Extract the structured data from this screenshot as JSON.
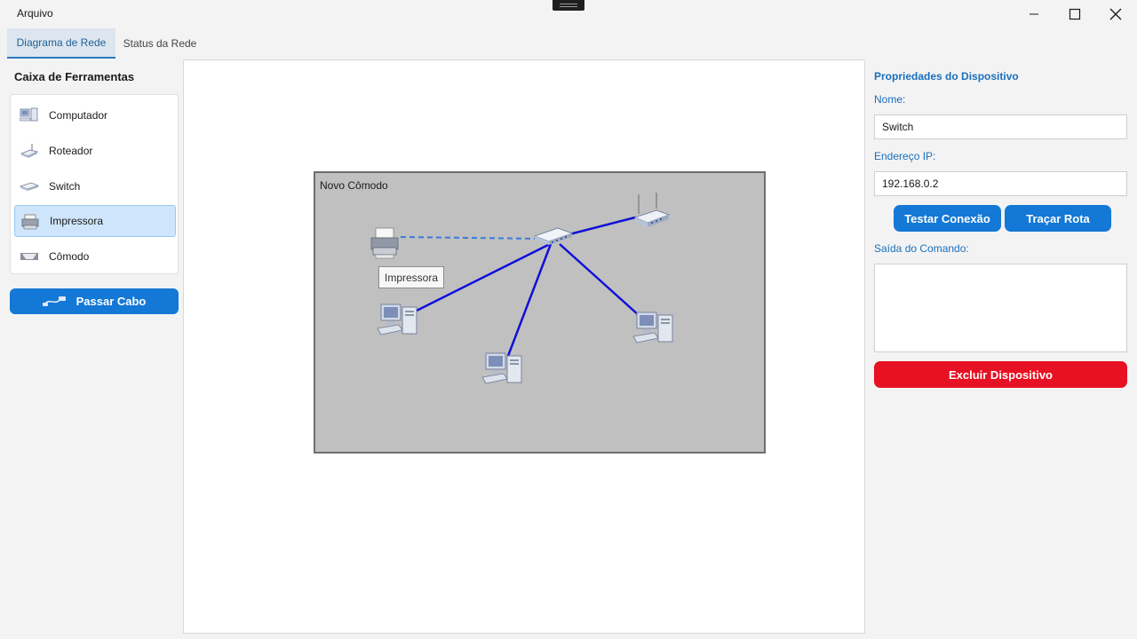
{
  "window": {
    "menu_file": "Arquivo"
  },
  "tabs": [
    {
      "label": "Diagrama de Rede",
      "active": true
    },
    {
      "label": "Status da Rede",
      "active": false
    }
  ],
  "toolbox": {
    "title": "Caixa de Ferramentas",
    "items": [
      {
        "label": "Computador",
        "icon": "computer-icon"
      },
      {
        "label": "Roteador",
        "icon": "router-icon"
      },
      {
        "label": "Switch",
        "icon": "switch-icon"
      },
      {
        "label": "Impressora",
        "icon": "printer-icon",
        "selected": true
      },
      {
        "label": "Cômodo",
        "icon": "room-icon"
      }
    ],
    "cable_button": "Passar Cabo"
  },
  "canvas": {
    "room_label": "Novo Cômodo",
    "tooltip": "Impressora"
  },
  "properties": {
    "title": "Propriedades do Dispositivo",
    "name_label": "Nome:",
    "name_value": "Switch",
    "ip_label": "Endereço IP:",
    "ip_value": "192.168.0.2",
    "test_button": "Testar Conexão",
    "trace_button": "Traçar Rota",
    "output_label": "Saída do Comando:",
    "output_value": "",
    "delete_button": "Excluir Dispositivo"
  },
  "colors": {
    "accent": "#1378d6",
    "danger": "#e81123",
    "cable": "#1010d8",
    "room": "#c0c0c0"
  }
}
